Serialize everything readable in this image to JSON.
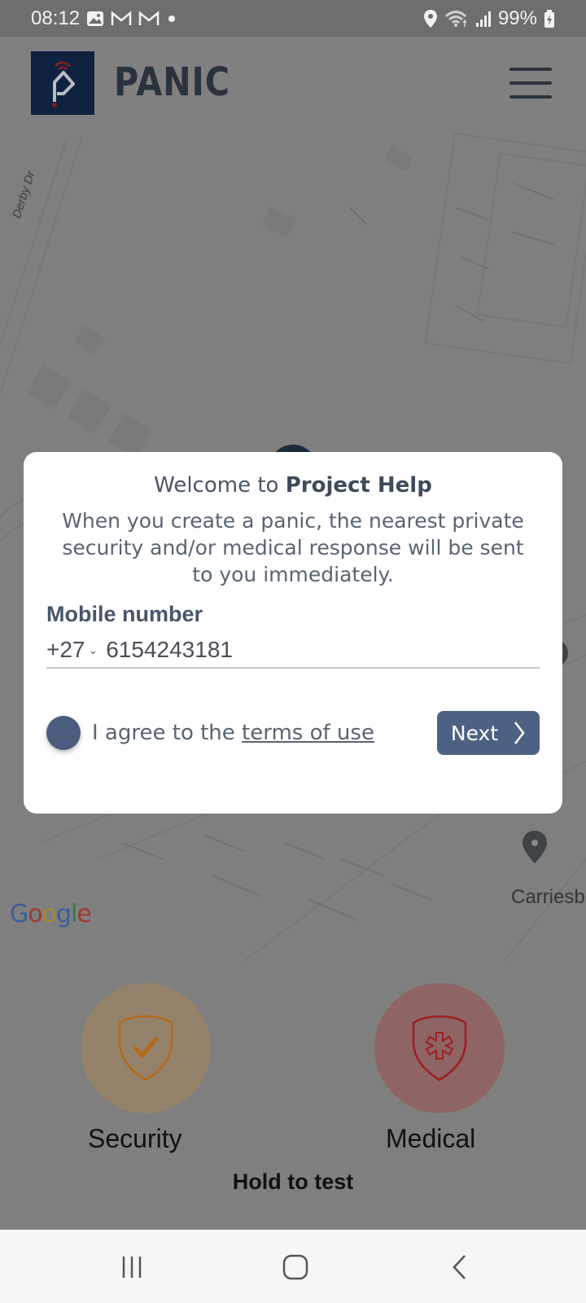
{
  "status_bar": {
    "time": "08:12",
    "notification_icons": [
      "gallery-icon",
      "gmail-icon",
      "gmail-icon",
      "dot-icon"
    ],
    "battery": "99%",
    "system_icons": [
      "location-icon",
      "wifi-icon",
      "signal-icon",
      "battery-charging-icon"
    ]
  },
  "header": {
    "app_title": "PANIC",
    "menu_icon": "hamburger-menu-icon"
  },
  "map": {
    "street_labels": [
      "Derby Dr",
      "Carriesb"
    ],
    "attribution": "Google"
  },
  "modal": {
    "title_prefix": "Welcome to ",
    "title_brand": "Project Help",
    "description": "When you create a panic, the nearest private security and/or medical response will be sent to you immediately.",
    "mobile_label": "Mobile number",
    "country_code": "+27",
    "phone_value": "6154243181",
    "agree_prefix": "I agree to the ",
    "terms_link": "terms of use",
    "agree_checked": false,
    "next_label": "Next"
  },
  "panic_buttons": [
    {
      "label": "Security",
      "icon": "shield-check-icon",
      "color": "#e8a04a"
    },
    {
      "label": "Medical",
      "icon": "shield-star-of-life-icon",
      "color": "#e05252"
    }
  ],
  "hold_text": "Hold to test",
  "nav_bar": {
    "buttons": [
      "recent-apps",
      "home",
      "back"
    ]
  }
}
